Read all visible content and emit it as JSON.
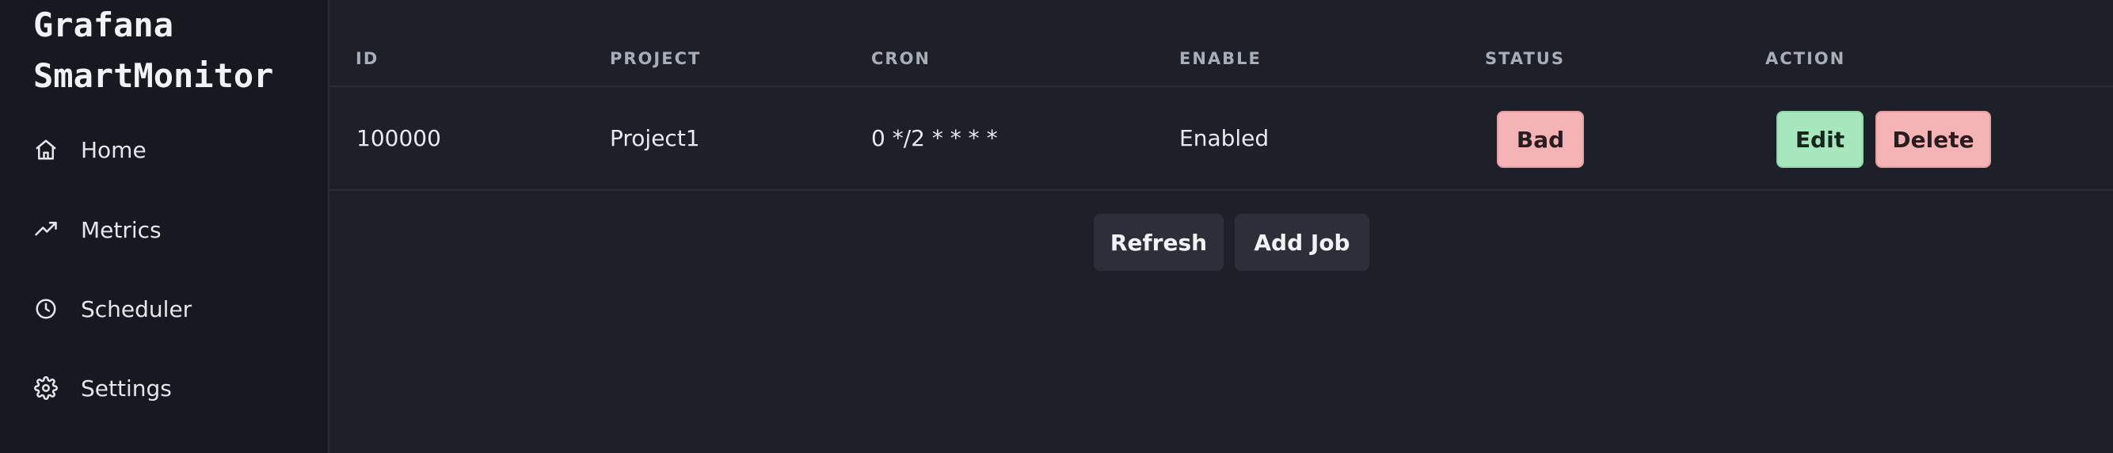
{
  "sidebar": {
    "brand_line1": "Grafana",
    "brand_line2": "SmartMonitor",
    "items": [
      {
        "label": "Home",
        "icon": "home-icon"
      },
      {
        "label": "Metrics",
        "icon": "trending-up-icon"
      },
      {
        "label": "Scheduler",
        "icon": "clock-icon"
      },
      {
        "label": "Settings",
        "icon": "gear-icon"
      }
    ]
  },
  "table": {
    "columns": [
      "ID",
      "PROJECT",
      "CRON",
      "ENABLE",
      "STATUS",
      "ACTION"
    ],
    "rows": [
      {
        "id": "100000",
        "project": "Project1",
        "cron": "0 */2 * * * *",
        "enable": "Enabled",
        "status": "Bad",
        "actions": [
          "Edit",
          "Delete"
        ]
      }
    ]
  },
  "buttons": {
    "refresh": "Refresh",
    "add_job": "Add Job"
  },
  "colors": {
    "background": "#1e2029",
    "sidebar": "#181920",
    "status_bad": "#f4b3b5",
    "edit": "#a8e6bd",
    "delete": "#f4b3b5",
    "secondary_button": "#2c2f3a"
  }
}
